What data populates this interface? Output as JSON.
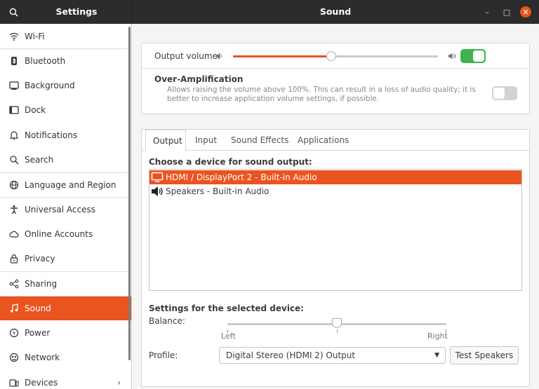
{
  "window": {
    "app_title": "Settings",
    "panel_title": "Sound",
    "min_glyph": "–",
    "max_glyph": "□",
    "close_glyph": "✕"
  },
  "sidebar": {
    "items": [
      {
        "label": "Wi-Fi",
        "icon": "wifi-icon"
      },
      {
        "label": "Bluetooth",
        "icon": "bluetooth-icon"
      },
      {
        "label": "Background",
        "icon": "background-icon"
      },
      {
        "label": "Dock",
        "icon": "dock-icon"
      },
      {
        "label": "Notifications",
        "icon": "bell-icon"
      },
      {
        "label": "Search",
        "icon": "search-icon"
      },
      {
        "label": "Language and Region",
        "icon": "globe-icon"
      },
      {
        "label": "Universal Access",
        "icon": "accessibility-icon"
      },
      {
        "label": "Online Accounts",
        "icon": "cloud-icon"
      },
      {
        "label": "Privacy",
        "icon": "lock-icon"
      },
      {
        "label": "Sharing",
        "icon": "share-icon"
      },
      {
        "label": "Sound",
        "icon": "music-note-icon"
      },
      {
        "label": "Power",
        "icon": "power-icon"
      },
      {
        "label": "Network",
        "icon": "network-icon"
      },
      {
        "label": "Devices",
        "icon": "devices-icon"
      }
    ],
    "active": "Sound",
    "devices_chevron": "›"
  },
  "output_volume": {
    "label": "Output volume:",
    "level": 0.48,
    "enabled": true
  },
  "over_amplification": {
    "title": "Over-Amplification",
    "description": "Allows raising the volume above 100%. This can result in a loss of audio quality; it is better to increase application volume settings, if possible.",
    "enabled": false
  },
  "tabs": [
    "Output",
    "Input",
    "Sound Effects",
    "Applications"
  ],
  "active_tab": "Output",
  "output": {
    "choose_title": "Choose a device for sound output:",
    "devices": [
      {
        "label": "HDMI / DisplayPort 2 - Built-in Audio",
        "icon": "monitor-icon",
        "selected": true
      },
      {
        "label": "Speakers - Built-in Audio",
        "icon": "speaker-icon",
        "selected": false
      }
    ],
    "settings_title": "Settings for the selected device:",
    "balance_label": "Balance:",
    "balance_value": 0.5,
    "balance_left": "Left",
    "balance_right": "Right",
    "profile_label": "Profile:",
    "profile_value": "Digital Stereo (HDMI 2) Output",
    "test_button": "Test Speakers"
  },
  "colors": {
    "accent": "#e95420",
    "toggle_on": "#3eb34f",
    "toggle_off": "#d6d2ce",
    "titlebar": "#2c2c2c"
  }
}
